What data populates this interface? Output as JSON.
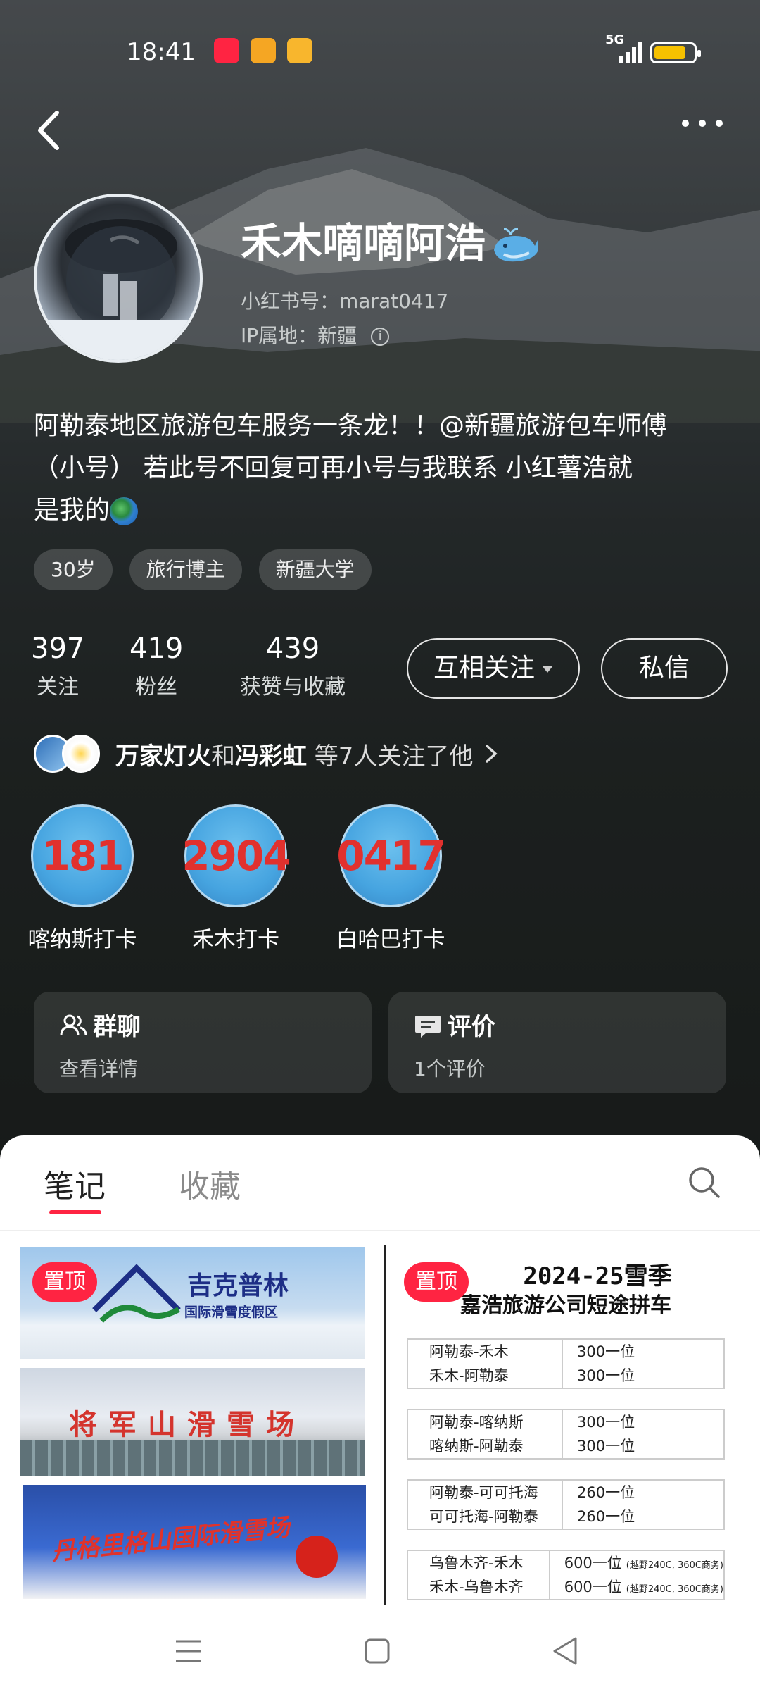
{
  "status_bar": {
    "time": "18:41",
    "network": "5G",
    "apps": [
      {
        "icon": "xiaohongshu-icon",
        "color": "#ff2442"
      },
      {
        "icon": "video-app-icon",
        "color": "#f5a623"
      },
      {
        "icon": "book-app-icon",
        "color": "#f8b62d"
      }
    ],
    "battery_color": "#f6c100"
  },
  "nav": {
    "back_icon": "chevron-left-icon",
    "more_icon": "more-dots-icon"
  },
  "profile": {
    "nickname": "禾木嘀嘀阿浩",
    "id_line": "小红书号：marat0417",
    "ip_line": "IP属地：新疆",
    "bio_line1": "阿勒泰地区旅游包车服务一条龙！！@新疆旅游包车师傅",
    "bio_line2": "（小号） 若此号不回复可再小号与我联系  小红薯浩就",
    "bio_line3": "是我的",
    "tags": [
      "30岁",
      "旅行博主",
      "新疆大学"
    ]
  },
  "stats": [
    {
      "num": "397",
      "label": "关注"
    },
    {
      "num": "419",
      "label": "粉丝"
    },
    {
      "num": "439",
      "label": "获赞与收藏"
    }
  ],
  "actions": {
    "follow_label": "互相关注",
    "message_label": "私信"
  },
  "mutual": {
    "name1": "万家灯火",
    "joiner": "和",
    "name2": "冯彩虹",
    "rest": " 等7人关注了他"
  },
  "highlights": [
    {
      "cover": "181",
      "label": "喀纳斯打卡"
    },
    {
      "cover": "2904",
      "label": "禾木打卡"
    },
    {
      "cover": "0417",
      "label": "白哈巴打卡"
    }
  ],
  "cards": [
    {
      "title": "群聊",
      "sub": "查看详情",
      "icon": "group-icon"
    },
    {
      "title": "评价",
      "sub": "1个评价",
      "icon": "comment-icon"
    }
  ],
  "tabs": {
    "notes": "笔记",
    "favorites": "收藏"
  },
  "posts": {
    "pinned_label": "置顶",
    "left": {
      "sign1_title": "吉克普林",
      "sign1_sub": "国际滑雪度假区",
      "sign2": "将军山滑雪场",
      "sign3": "丹格里格山国际滑雪场"
    },
    "right": {
      "title1": "2024-25雪季",
      "title2": "嘉浩旅游公司短途拼车",
      "groups": [
        {
          "rows": [
            {
              "route": "阿勒泰-禾木",
              "fare": "300一位",
              "note": ""
            },
            {
              "route": "禾木-阿勒泰",
              "fare": "300一位",
              "note": ""
            }
          ]
        },
        {
          "rows": [
            {
              "route": "阿勒泰-喀纳斯",
              "fare": "300一位",
              "note": ""
            },
            {
              "route": "喀纳斯-阿勒泰",
              "fare": "300一位",
              "note": ""
            }
          ]
        },
        {
          "rows": [
            {
              "route": "阿勒泰-可可托海",
              "fare": "260一位",
              "note": ""
            },
            {
              "route": "可可托海-阿勒泰",
              "fare": "260一位",
              "note": ""
            }
          ]
        },
        {
          "rows": [
            {
              "route": "乌鲁木齐-禾木",
              "fare": "600一位",
              "note": "(越野240C, 360C商务)"
            },
            {
              "route": "禾木-乌鲁木齐",
              "fare": "600一位",
              "note": "(越野240C, 360C商务)"
            }
          ]
        }
      ]
    }
  },
  "colors": {
    "accent": "#ff2442",
    "highlight_digits": "#e1312e"
  }
}
